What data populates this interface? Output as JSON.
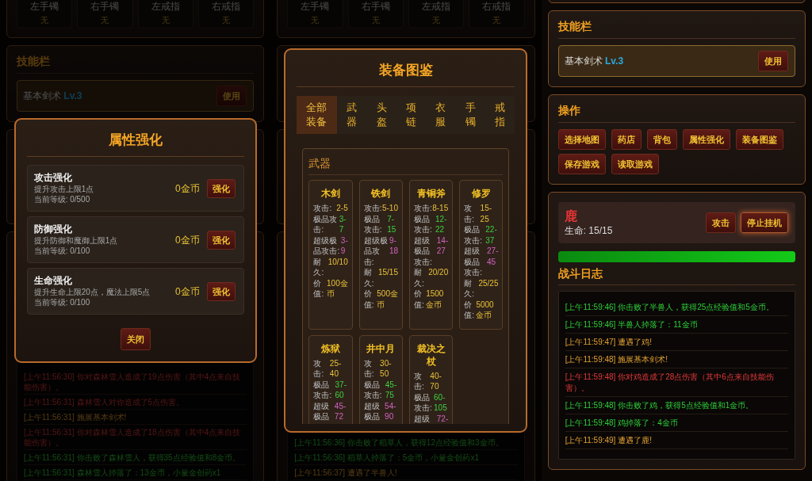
{
  "views": [
    {
      "equipment_slots": [
        {
          "label": "左手镯",
          "value": "无"
        },
        {
          "label": "右手镯",
          "value": "无"
        },
        {
          "label": "左戒指",
          "value": "无"
        },
        {
          "label": "右戒指",
          "value": "无"
        }
      ],
      "skill_panel": {
        "title": "技能栏",
        "skills": [
          {
            "name": "基本剑术",
            "rank": "Lv.3",
            "button": "使用"
          }
        ]
      },
      "battle_log": [
        {
          "kind": "damage",
          "text": "[上午11:56:30] 你对森林雪人造成了19点伤害（其中4点来自技能伤害）。"
        },
        {
          "kind": "damage",
          "text": "[上午11:56:31] 森林雪人对你造成了5点伤害。"
        },
        {
          "kind": "event",
          "text": "[上午11:56:31] 施展基本剑术!"
        },
        {
          "kind": "damage",
          "text": "[上午11:56:31] 你对森林雪人造成了18点伤害（其中4点来自技能伤害）。"
        },
        {
          "kind": "reward",
          "text": "[上午11:56:31] 你击败了森林雪人，获得35点经验值和8金币。"
        },
        {
          "kind": "reward",
          "text": "[上午11:56:31] 森林雪人掉落了：13金币，小量金创药x1"
        }
      ],
      "modal": {
        "kind": "upgrades",
        "title": "属性强化",
        "upgrades": [
          {
            "name": "攻击强化",
            "description": "提升攻击上限1点",
            "current": "当前等级: 0/500",
            "cost": "0金币",
            "button": "强化"
          },
          {
            "name": "防御强化",
            "description": "提升防御和魔御上限1点",
            "current": "当前等级: 0/100",
            "cost": "0金币",
            "button": "强化"
          },
          {
            "name": "生命强化",
            "description": "提升生命上限20点，魔法上限5点",
            "current": "当前等级: 0/100",
            "cost": "0金币",
            "button": "强化"
          }
        ],
        "close_button": "关闭"
      }
    },
    {
      "equipment_slots": [
        {
          "label": "左手镯",
          "value": "无"
        },
        {
          "label": "右手镯",
          "value": "无"
        },
        {
          "label": "左戒指",
          "value": "无"
        },
        {
          "label": "右戒指",
          "value": "无"
        }
      ],
      "battle_log": [
        {
          "kind": "reward",
          "text": "[上午11:56:36] 你击败了稻草人，获得12点经验值和3金币。"
        },
        {
          "kind": "reward",
          "text": "[上午11:56:36] 稻草人掉落了：5金币，小量金创药x1"
        },
        {
          "kind": "event",
          "text": "[上午11:56:37] 遭遇了半兽人!"
        }
      ],
      "modal": {
        "kind": "catalog",
        "title": "装备图鉴",
        "tabs": [
          {
            "label": "全部装备",
            "selected": true
          },
          {
            "label": "武器",
            "selected": false
          },
          {
            "label": "头盔",
            "selected": false
          },
          {
            "label": "项链",
            "selected": false
          },
          {
            "label": "衣服",
            "selected": false
          },
          {
            "label": "手镯",
            "selected": false
          },
          {
            "label": "戒指",
            "selected": false
          }
        ],
        "sections": [
          {
            "title": "武器",
            "items": [
              {
                "name": "木剑",
                "stats": [
                  {
                    "kind": "attack",
                    "label": "攻击:",
                    "value": "2-5"
                  },
                  {
                    "kind": "excellent",
                    "label": "极品攻击:",
                    "value": "3-7"
                  },
                  {
                    "kind": "super",
                    "label": "超级极品攻击:",
                    "value": "3-9"
                  },
                  {
                    "kind": "durability",
                    "label": "耐久:",
                    "value": "10/10"
                  },
                  {
                    "kind": "price",
                    "label": "价值:",
                    "value": "100金币"
                  }
                ]
              },
              {
                "name": "铁剑",
                "stats": [
                  {
                    "kind": "attack",
                    "label": "攻击:",
                    "value": "5-10"
                  },
                  {
                    "kind": "excellent",
                    "label": "极品攻击:",
                    "value": "7-15"
                  },
                  {
                    "kind": "super",
                    "label": "超级极品攻击:",
                    "value": "9-18"
                  },
                  {
                    "kind": "durability",
                    "label": "耐久:",
                    "value": "15/15"
                  },
                  {
                    "kind": "price",
                    "label": "价值:",
                    "value": "500金币"
                  }
                ]
              },
              {
                "name": "青铜斧",
                "stats": [
                  {
                    "kind": "attack",
                    "label": "攻击:",
                    "value": "8-15"
                  },
                  {
                    "kind": "excellent",
                    "label": "极品攻击:",
                    "value": "12-22"
                  },
                  {
                    "kind": "super",
                    "label": "超级极品攻击:",
                    "value": "14-27"
                  },
                  {
                    "kind": "durability",
                    "label": "耐久:",
                    "value": "20/20"
                  },
                  {
                    "kind": "price",
                    "label": "价值:",
                    "value": "1500金币"
                  }
                ]
              },
              {
                "name": "修罗",
                "stats": [
                  {
                    "kind": "attack",
                    "label": "攻击:",
                    "value": "15-25"
                  },
                  {
                    "kind": "excellent",
                    "label": "极品攻击:",
                    "value": "22-37"
                  },
                  {
                    "kind": "super",
                    "label": "超级极品攻击:",
                    "value": "27-45"
                  },
                  {
                    "kind": "durability",
                    "label": "耐久:",
                    "value": "25/25"
                  },
                  {
                    "kind": "price",
                    "label": "价值:",
                    "value": "5000金币"
                  }
                ]
              },
              {
                "name": "炼狱",
                "stats": [
                  {
                    "kind": "attack",
                    "label": "攻击:",
                    "value": "25-40"
                  },
                  {
                    "kind": "excellent",
                    "label": "极品攻击:",
                    "value": "37-60"
                  },
                  {
                    "kind": "super",
                    "label": "超级极品",
                    "value": "45-72"
                  }
                ]
              },
              {
                "name": "井中月",
                "stats": [
                  {
                    "kind": "attack",
                    "label": "攻击:",
                    "value": "30-50"
                  },
                  {
                    "kind": "excellent",
                    "label": "极品攻击:",
                    "value": "45-75"
                  },
                  {
                    "kind": "super",
                    "label": "超级极品",
                    "value": "54-90"
                  }
                ]
              },
              {
                "name": "裁决之杖",
                "stats": [
                  {
                    "kind": "attack",
                    "label": "攻击:",
                    "value": "40-70"
                  },
                  {
                    "kind": "excellent",
                    "label": "极品攻击:",
                    "value": "60-105"
                  },
                  {
                    "kind": "super",
                    "label": "超级",
                    "value": "72-"
                  }
                ]
              }
            ]
          }
        ]
      }
    },
    {
      "skill_panel": {
        "title": "技能栏",
        "skills": [
          {
            "name": "基本剑术",
            "rank": "Lv.3",
            "button": "使用"
          }
        ]
      },
      "operations": {
        "title": "操作",
        "buttons": [
          "选择地图",
          "药店",
          "背包",
          "属性强化",
          "装备图鉴",
          "保存游戏",
          "读取游戏"
        ]
      },
      "battle": {
        "enemy": {
          "name": "鹿",
          "hp": "生命: 15/15",
          "buttons": [
            {
              "label": "攻击",
              "active": false
            },
            {
              "label": "停止挂机",
              "active": true
            }
          ]
        },
        "hp_bar": {
          "level": 1
        },
        "log_title": "战斗日志"
      },
      "battle_log": [
        {
          "kind": "reward",
          "text": "[上午11:59:46] 你击败了半兽人，获得25点经验值和5金币。"
        },
        {
          "kind": "reward",
          "text": "[上午11:59:46] 半兽人掉落了：11金币"
        },
        {
          "kind": "event",
          "text": "[上午11:59:47] 遭遇了鸡!"
        },
        {
          "kind": "event",
          "text": "[上午11:59:48] 施展基本剑术!"
        },
        {
          "kind": "damage",
          "text": "[上午11:59:48] 你对鸡造成了28点伤害（其中6点来自技能伤害）。"
        },
        {
          "kind": "reward",
          "text": "[上午11:59:48] 你击败了鸡，获得5点经验值和1金币。"
        },
        {
          "kind": "reward",
          "text": "[上午11:59:48] 鸡掉落了：4金币"
        },
        {
          "kind": "event",
          "text": "[上午11:59:49] 遭遇了鹿!"
        }
      ]
    }
  ]
}
